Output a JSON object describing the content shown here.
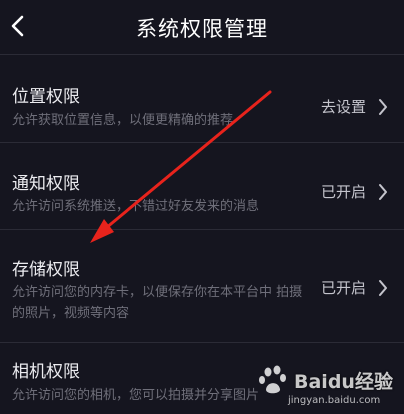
{
  "header": {
    "title": "系统权限管理"
  },
  "items": [
    {
      "title": "位置权限",
      "desc": "允许获取位置信息，以便更精确的推荐",
      "status": "去设置"
    },
    {
      "title": "通知权限",
      "desc": "允许访问系统推送，不错过好友发来的消息",
      "status": "已开启"
    },
    {
      "title": "存储权限",
      "desc": "允许访问您的内存卡，以便保存你在本平台中 拍摄的照片，视频等内容",
      "status": "已开启"
    },
    {
      "title": "相机权限",
      "desc": "允许访问您的相机，您可以拍摄并分享图片",
      "status": ""
    }
  ],
  "watermark": {
    "brand": "Baidu经验",
    "url": "jingyan.baidu.com"
  },
  "colors": {
    "background": "#15151f",
    "annotation_arrow": "#e8231c"
  },
  "icons": [
    "back-chevron-icon",
    "chevron-right-icon",
    "baidu-paw-icon"
  ]
}
